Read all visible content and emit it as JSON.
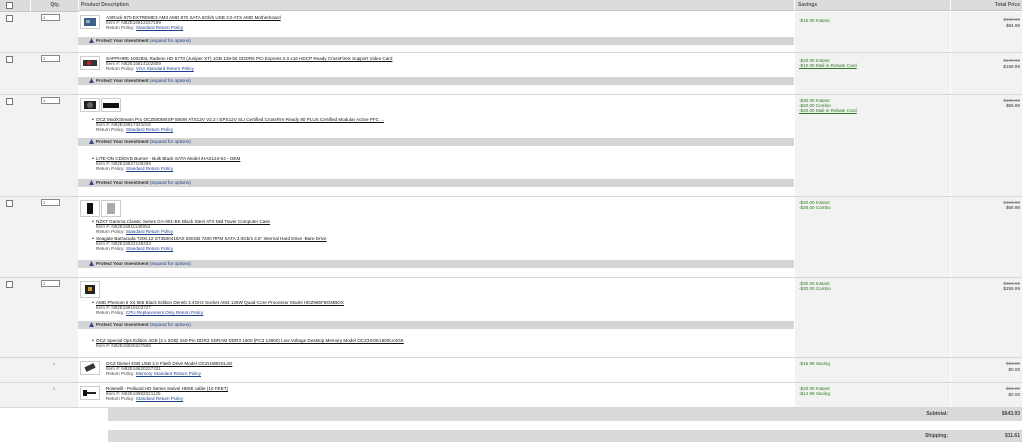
{
  "header": {
    "qty_label": "Qty.",
    "description_label": "Product Description",
    "savings_label": "Savings",
    "total_label": "Total Price"
  },
  "colors": {
    "header_bg": "#dcdcdc",
    "savings_text": "#2b7a1f",
    "link": "#1c3f8c",
    "protect_bar": "#d5d5d5"
  },
  "protect": {
    "label": "Protect Your Investment",
    "link": "(expand for options)"
  },
  "rows": [
    {
      "qty": "1",
      "items": [
        {
          "name": "ASRock 870 EXTREME3 AM3 AMD 870 SATA 6Gb/s USB 3.0 ATX AMD Motherboard",
          "item_no": "Item #:  N82E16813157199",
          "policy_label": "Return Policy:",
          "policy": "Standard Return Policy"
        }
      ],
      "savings": [
        "-$15.00 Instant"
      ],
      "price_old": "$109.99",
      "price_new": "$94.99"
    },
    {
      "qty": "1",
      "items": [
        {
          "name": "SAPPHIRE 100283L Radeon HD 5770 (Juniper XT) 1GB 128-bit GDDR5 PCI Express 2.0 x16 HDCP Ready CrossFireX Support Video Card",
          "item_no": "Item #:  N82E16814102859",
          "policy_label": "Return Policy:",
          "policy": "VGA Standard Return Policy"
        }
      ],
      "savings": [
        "-$20.00 Instant",
        "-$10.00 Mail-in Rebate Card"
      ],
      "price_old": "$179.99",
      "price_new": "$159.99"
    },
    {
      "qty": "1",
      "items": [
        {
          "name": "OCZ ModXStream Pro OCZ500MXSP 500W ATX12V V2.2 / EPS12V SLI Certified CrossFire Ready 80 PLUS Certified Modular Active PFC ...",
          "item_no": "Item #:  N82E16817341016",
          "policy_label": "Return Policy:",
          "policy": "Standard Return Policy"
        },
        {
          "name": "LITE-ON CD/DVD Burner - Bulk Black SATA Model iHAS124-04 - OEM",
          "item_no": "Item #:  N82E16827106289",
          "policy_label": "Return Policy:",
          "policy": "Standard Return Policy"
        }
      ],
      "savings": [
        "-$30.00 Instant",
        "-$20.00 Combo",
        "-$20.00 Mail-in Rebate Card"
      ],
      "price_old": "$109.99",
      "price_new": "$59.99"
    },
    {
      "qty": "1",
      "items": [
        {
          "name": "NZXT Gamma Classic Series GA-001-BK Black Steel ATX Mid Tower Computer Case",
          "item_no": "Item #:  N82E16811146054",
          "policy_label": "Return Policy:",
          "policy": "Standard Return Policy"
        },
        {
          "name": "Seagate Barracuda 7200.12 ST3500418AS 500GB 7200 RPM SATA 3.0Gb/s 3.5\" Internal Hard Drive -Bare Drive",
          "item_no": "Item #:  N82E16822148433",
          "policy_label": "Return Policy:",
          "policy": "Standard Return Policy"
        }
      ],
      "savings": [
        "-$20.00 Instant",
        "-$36.00 Combo"
      ],
      "price_old": "$124.98",
      "price_new": "$68.98"
    },
    {
      "qty": "1",
      "items": [
        {
          "name": "AMD Phenom II X4 965 Black Edition Deneb 3.4GHz Socket AM3 125W Quad-Core Processor Model HDZ965FBGMBOX",
          "item_no": "Item #:  N82E16819103727",
          "policy_label": "Return Policy:",
          "policy": "CPU Replacement Only Return Policy"
        },
        {
          "name": "OCZ Special Ops Edition 4GB (2 x 2GB) 240-Pin DDR3 SDRAM DDR3 1600 (PC3 12800) Low Voltage Desktop Memory Model OCZ3SOE1600LV4GK",
          "item_no": "Item #:  N82E16820227556",
          "policy_label": "",
          "policy": ""
        }
      ],
      "savings": [
        "-$30.00 Instant",
        "-$30.00 Combo"
      ],
      "price_old": "$319.99",
      "price_new": "$259.99"
    },
    {
      "qty": "1",
      "items": [
        {
          "name": "OCZ Diesel 4GB USB 2.0 Flash Drive Model OCZUSBDSL4G",
          "item_no": "Item #:  N82E16820227331",
          "policy_label": "Return Policy:",
          "policy": "Memory Standard Return Policy"
        }
      ],
      "savings": [
        "-$15.99 Saving"
      ],
      "price_old": "$15.99",
      "price_new": "$0.00"
    },
    {
      "qty": "1",
      "items": [
        {
          "name": "Rosewill - Pelluoid HD Series Swivel HDMI cable (10 FEET)",
          "item_no": "Item #:  N82E16882021125",
          "policy_label": "Return Policy:",
          "policy": "Standard Return Policy"
        }
      ],
      "savings": [
        "-$20.00 Instant",
        "-$14.99 Saving"
      ],
      "price_old": "$34.99",
      "price_new": "$0.00"
    }
  ],
  "summary": {
    "subtotal_label": "Subtotal:",
    "subtotal_value": "$643.93",
    "shipping_label": "Shipping:",
    "shipping_value": "$11.61"
  }
}
